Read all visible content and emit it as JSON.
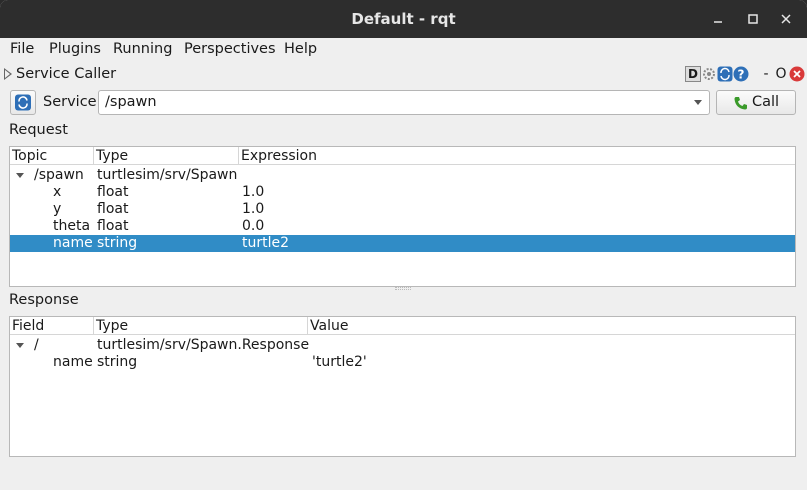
{
  "window": {
    "title": "Default - rqt"
  },
  "menubar": {
    "items": [
      {
        "label": "File"
      },
      {
        "label": "Plugins"
      },
      {
        "label": "Running"
      },
      {
        "label": "Perspectives"
      },
      {
        "label": "Help"
      }
    ]
  },
  "plugin": {
    "title": "Service Caller",
    "d_label": "D",
    "o_label": "O",
    "dash_label": "-"
  },
  "service": {
    "label": "Service",
    "value": "/spawn",
    "call_label": "Call"
  },
  "request": {
    "section_label": "Request",
    "columns": [
      "Topic",
      "Type",
      "Expression"
    ],
    "rows": [
      {
        "topic": "/spawn",
        "type": "turtlesim/srv/Spawn",
        "expression": ""
      },
      {
        "topic": "x",
        "type": "float",
        "expression": "1.0"
      },
      {
        "topic": "y",
        "type": "float",
        "expression": "1.0"
      },
      {
        "topic": "theta",
        "type": "float",
        "expression": "0.0"
      },
      {
        "topic": "name",
        "type": "string",
        "expression": "turtle2"
      }
    ]
  },
  "response": {
    "section_label": "Response",
    "columns": [
      "Field",
      "Type",
      "Value"
    ],
    "rows": [
      {
        "field": "/",
        "type": "turtlesim/srv/Spawn.Response",
        "value": ""
      },
      {
        "field": "name",
        "type": "string",
        "value": "'turtle2'"
      }
    ]
  },
  "colors": {
    "selection": "#308cc6",
    "titlebar": "#2d2d2d",
    "close_red": "#d93a3a",
    "call_green": "#3a9a2a",
    "icon_blue": "#2e6fb7"
  }
}
